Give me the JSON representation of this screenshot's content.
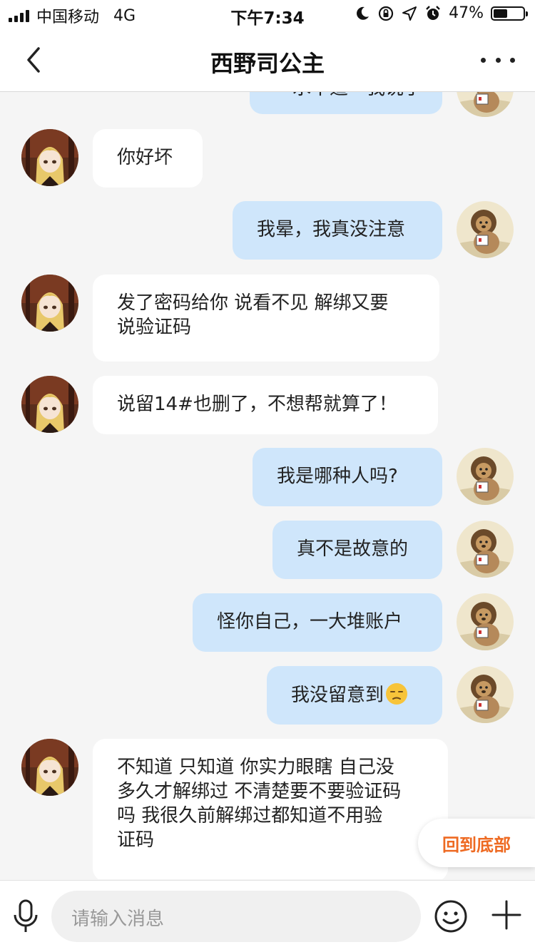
{
  "status_bar": {
    "carrier": "中国移动",
    "network": "4G",
    "time": "下午7:34",
    "battery": "47%",
    "battery_level": 0.47
  },
  "header": {
    "title": "西野司公主"
  },
  "messages": [
    {
      "side": "out",
      "text": "一水不道一我说了"
    },
    {
      "side": "in",
      "text": "你好坏"
    },
    {
      "side": "out",
      "text": "我晕，我真没注意"
    },
    {
      "side": "in",
      "lines": [
        "发了密码给你 说看不见  解绑又要",
        "说验证码"
      ]
    },
    {
      "side": "in",
      "text": "说留14#也删了，不想帮就算了！"
    },
    {
      "side": "out",
      "text": "我是哪种人吗?"
    },
    {
      "side": "out",
      "text": "真不是故意的"
    },
    {
      "side": "out",
      "text": "怪你自己，一大堆账户"
    },
    {
      "side": "out",
      "text": "我没留意到",
      "emoji": "unamused-face-icon"
    },
    {
      "side": "in",
      "lines": [
        "不知道 只知道 你实力眼瞎  自己没",
        "多久才解绑过 不清楚要不要验证码",
        "吗  我很久前解绑过都知道不用验",
        "证码"
      ]
    }
  ],
  "scroll_bottom_label": "回到底部",
  "input": {
    "placeholder": "请输入消息"
  },
  "icons": {
    "back": "chevron-left-icon",
    "more": "more-dots-icon",
    "mic": "microphone-icon",
    "emoji": "emoji-icon",
    "plus": "plus-icon"
  },
  "colors": {
    "outgoing_bubble": "#cfe6fb",
    "incoming_bubble": "#ffffff",
    "accent": "#ee6a22"
  }
}
